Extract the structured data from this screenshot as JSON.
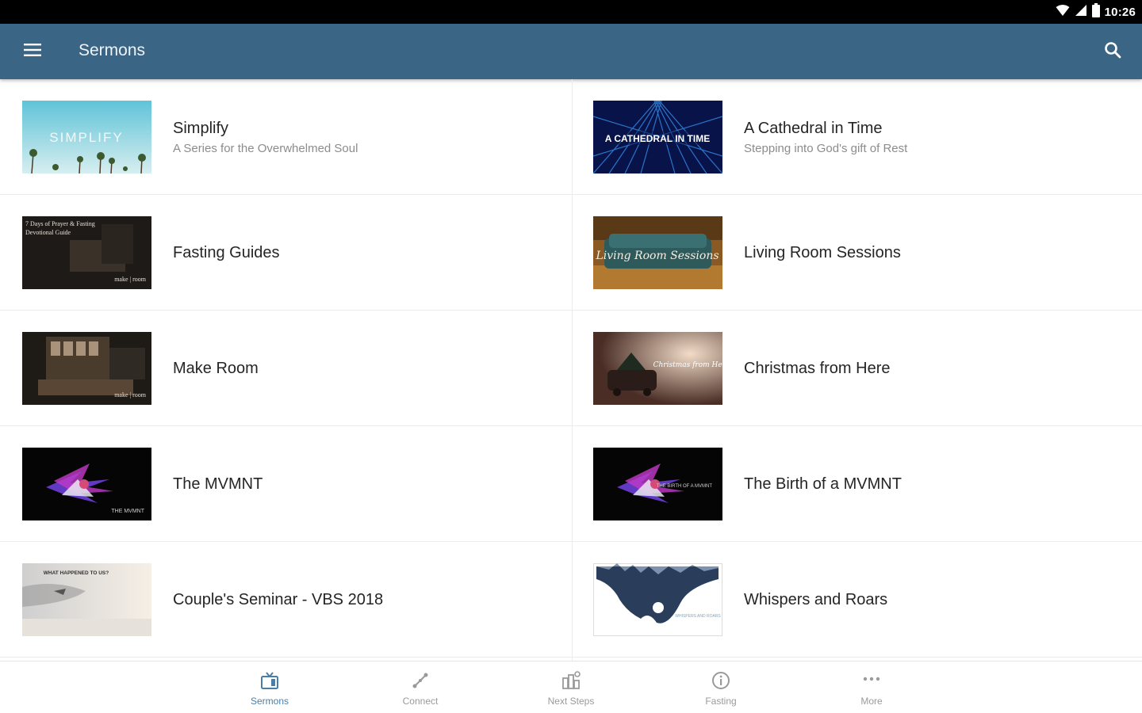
{
  "status_bar": {
    "time": "10:26"
  },
  "app_bar": {
    "title": "Sermons"
  },
  "sermons": [
    {
      "title": "Simplify",
      "subtitle": "A Series for the Overwhelmed Soul",
      "thumb_text": "SIMPLIFY"
    },
    {
      "title": "A Cathedral in Time",
      "subtitle": "Stepping into God's gift of Rest",
      "thumb_text": "A CATHEDRAL IN TIME"
    },
    {
      "title": "Fasting Guides",
      "thumb_text": "7 Days of Prayer & Fasting Devotional Guide",
      "thumb_footer": "make | room"
    },
    {
      "title": "Living Room Sessions",
      "thumb_text": "Living Room Sessions"
    },
    {
      "title": "Make Room",
      "thumb_footer": "make | room"
    },
    {
      "title": "Christmas from Here",
      "thumb_text": "Christmas from Here"
    },
    {
      "title": "The MVMNT",
      "thumb_text": "THE MVMNT"
    },
    {
      "title": "The Birth of a MVMNT",
      "thumb_text": "THE BIRTH OF A MVMNT"
    },
    {
      "title": "Couple's Seminar - VBS 2018",
      "thumb_text": "WHAT HAPPENED TO US?"
    },
    {
      "title": "Whispers and Roars",
      "thumb_text": "WHISPERS AND ROARS"
    }
  ],
  "bottom_nav": [
    {
      "label": "Sermons",
      "icon": "tv-icon",
      "active": true
    },
    {
      "label": "Connect",
      "icon": "connect-icon"
    },
    {
      "label": "Next Steps",
      "icon": "next-steps-icon"
    },
    {
      "label": "Fasting",
      "icon": "info-icon"
    },
    {
      "label": "More",
      "icon": "more-dots-icon"
    }
  ],
  "colors": {
    "app_bar": "#3b6584",
    "active_tab": "#4a7ea8",
    "inactive_tab": "#9a9a9a"
  }
}
